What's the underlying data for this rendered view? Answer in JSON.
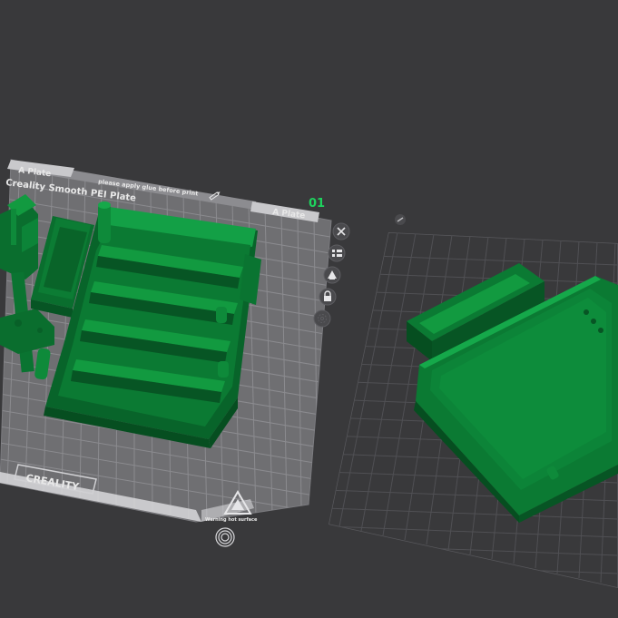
{
  "app": {
    "plate_number": "01"
  },
  "plate": {
    "tab_left": "A Plate",
    "tab_right": "A Plate",
    "name": "Creality Smooth PEI Plate",
    "notice": "please apply glue before print",
    "brand": "CREALITY",
    "warning": "Warning hot surface"
  },
  "toolbar": {
    "items": [
      {
        "icon": "close-icon"
      },
      {
        "icon": "arrange-icon"
      },
      {
        "icon": "orient-icon"
      },
      {
        "icon": "lock-icon"
      },
      {
        "icon": "settings-icon"
      }
    ]
  },
  "colors": {
    "background": "#39393b",
    "plate": "#6d6d70",
    "grid": "#8a8a8e",
    "model_green": "#0b7a33",
    "accent_green": "#1ed35e"
  }
}
